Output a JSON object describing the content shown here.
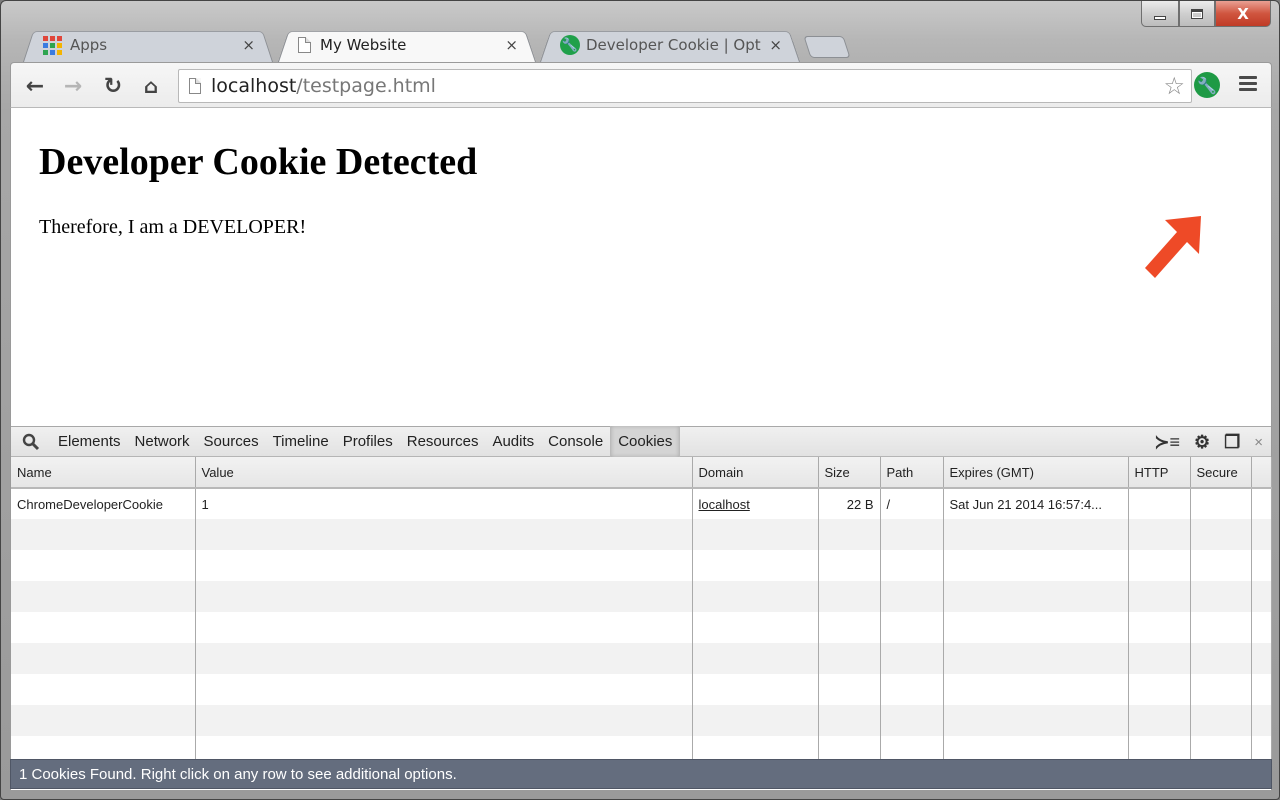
{
  "window": {
    "controls": {
      "minimize": "minimize",
      "maximize": "maximize",
      "close": "X"
    }
  },
  "tabs": [
    {
      "title": "Apps",
      "icon": "apps-grid-icon",
      "close": "×",
      "active": false
    },
    {
      "title": "My Website",
      "icon": "page-icon",
      "close": "×",
      "active": true
    },
    {
      "title": "Developer Cookie | Optior",
      "icon": "wrench-icon",
      "close": "×",
      "active": false
    }
  ],
  "toolbar": {
    "back": "←",
    "forward": "→",
    "reload": "↻",
    "home": "⌂",
    "url_host": "localhost",
    "url_path": "/testpage.html",
    "bookmark_star": "☆",
    "extension_icon": "🔧",
    "menu": "menu"
  },
  "page": {
    "heading": "Developer Cookie Detected",
    "paragraph": "Therefore, I am a DEVELOPER!"
  },
  "colors": {
    "annotation_arrow": "#ee4a27",
    "extension_green": "#1e9a45",
    "status_bar": "#646d7e"
  },
  "devtools": {
    "tabs": [
      "Elements",
      "Network",
      "Sources",
      "Timeline",
      "Profiles",
      "Resources",
      "Audits",
      "Console",
      "Cookies"
    ],
    "selected_tab": "Cookies",
    "right_icons": {
      "console_drawer": "≻≡",
      "settings": "⚙",
      "dock": "❐",
      "close": "×"
    },
    "columns": [
      "Name",
      "Value",
      "Domain",
      "Size",
      "Path",
      "Expires (GMT)",
      "HTTP",
      "Secure",
      ""
    ],
    "rows": [
      {
        "name": "ChromeDeveloperCookie",
        "value": "1",
        "domain": "localhost",
        "size": "22 B",
        "path": "/",
        "expires": "Sat Jun 21 2014 16:57:4...",
        "http": "",
        "secure": ""
      }
    ],
    "status": "1 Cookies Found. Right click on any row to see additional options."
  }
}
